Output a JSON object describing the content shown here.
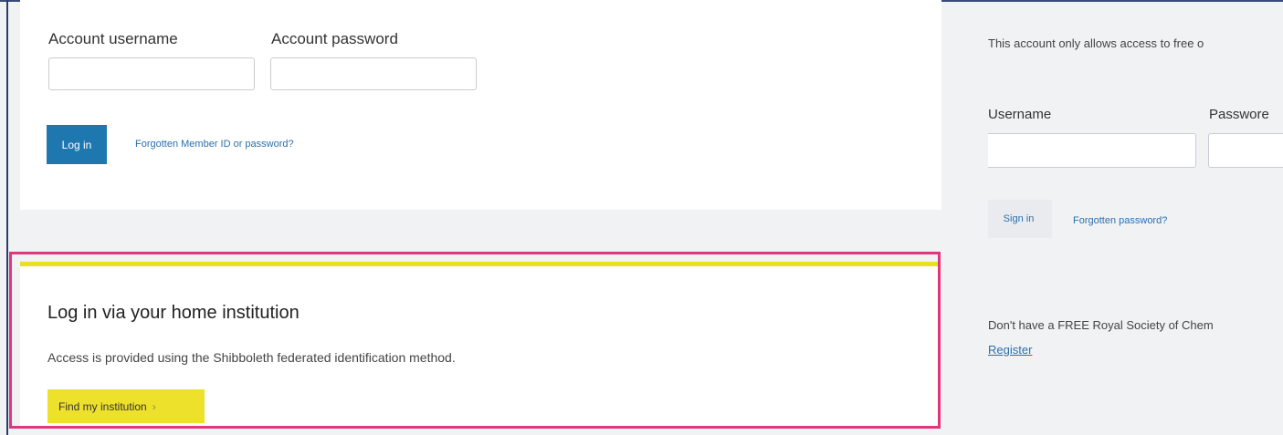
{
  "member_login": {
    "username_label": "Account username",
    "password_label": "Account password",
    "username_value": "",
    "password_value": "",
    "login_button": "Log in",
    "forgot_link": "Forgotten Member ID or password?"
  },
  "institution": {
    "title": "Log in via your home institution",
    "description": "Access is provided using the Shibboleth federated identification method.",
    "find_button": "Find my institution",
    "find_chevron": "›"
  },
  "rsc_login": {
    "notice": "This account only allows access to free o",
    "username_label": "Username",
    "password_label": "Passwore",
    "username_value": "",
    "password_value": "",
    "signin_button": "Sign in",
    "forgot_link": "Forgotten password?",
    "register_prompt": "Don't have a FREE Royal Society of Chem",
    "register_link": "Register"
  },
  "colors": {
    "login_button": "#1f77b0",
    "find_button": "#eee12b",
    "highlight_border": "#e1357d",
    "link": "#2a70ad"
  }
}
